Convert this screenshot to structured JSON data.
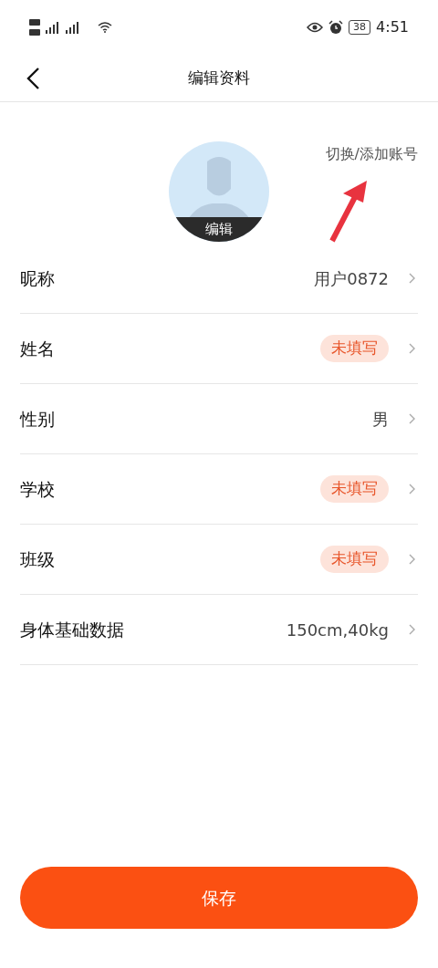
{
  "status_bar": {
    "battery": "38",
    "time": "4:51"
  },
  "header": {
    "title": "编辑资料"
  },
  "profile": {
    "avatar_label": "编辑",
    "switch_account": "切换/添加账号"
  },
  "rows": [
    {
      "label": "昵称",
      "kind": "value",
      "value": "用户0872"
    },
    {
      "label": "姓名",
      "kind": "badge",
      "value": "未填写"
    },
    {
      "label": "性别",
      "kind": "value",
      "value": "男"
    },
    {
      "label": "学校",
      "kind": "badge",
      "value": "未填写"
    },
    {
      "label": "班级",
      "kind": "badge",
      "value": "未填写"
    },
    {
      "label": "身体基础数据",
      "kind": "value",
      "value": "150cm,40kg"
    }
  ],
  "save_button": "保存"
}
